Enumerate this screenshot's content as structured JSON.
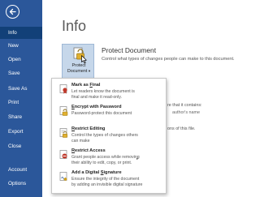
{
  "sidebar": {
    "items": [
      {
        "label": "Info",
        "active": true
      },
      {
        "label": "New"
      },
      {
        "label": "Open"
      },
      {
        "label": "Save"
      },
      {
        "label": "Save As"
      },
      {
        "label": "Print"
      },
      {
        "label": "Share"
      },
      {
        "label": "Export"
      },
      {
        "label": "Close"
      },
      {
        "label": "Account"
      },
      {
        "label": "Options"
      }
    ]
  },
  "page": {
    "title": "Info"
  },
  "protect": {
    "button_line1": "Protect",
    "button_line2": "Document",
    "heading": "Protect Document",
    "description": "Control what types of changes people can make to this document."
  },
  "background": {
    "inspect_text": "re that it contains:",
    "inspect_sub": "author's name",
    "versions_text": "ons of this file."
  },
  "menu": {
    "items": [
      {
        "title_pre": "Mark as ",
        "title_u": "F",
        "title_post": "inal",
        "desc_lines": [
          "Let readers know the document is",
          "final and make it read-only."
        ],
        "icon": "ribbon-icon"
      },
      {
        "title_pre": "",
        "title_u": "E",
        "title_post": "ncrypt with Password",
        "desc_lines": [
          "Password-protect this document"
        ],
        "icon": "lock-icon"
      },
      {
        "title_pre": "",
        "title_u": "R",
        "title_post": "estrict Editing",
        "desc_lines": [
          "Control the types of changes others",
          "can make"
        ],
        "icon": "restrict-editing-icon"
      },
      {
        "title_pre": "",
        "title_u": "R",
        "title_post": "estrict Access",
        "desc_lines": [
          "Grant people access while removing",
          "their ability to edit, copy, or print."
        ],
        "icon": "no-entry-icon"
      },
      {
        "title_pre": "Add a Digital ",
        "title_u": "S",
        "title_post": "ignature",
        "desc_lines": [
          "Ensure the integrity of the document",
          "by adding an invisible digital signature"
        ],
        "icon": "signature-icon"
      }
    ]
  },
  "colors": {
    "sidebar": "#2b579a",
    "sidebar_active": "#124078",
    "accent_red": "#c0392b",
    "accent_gold": "#d4a017"
  }
}
